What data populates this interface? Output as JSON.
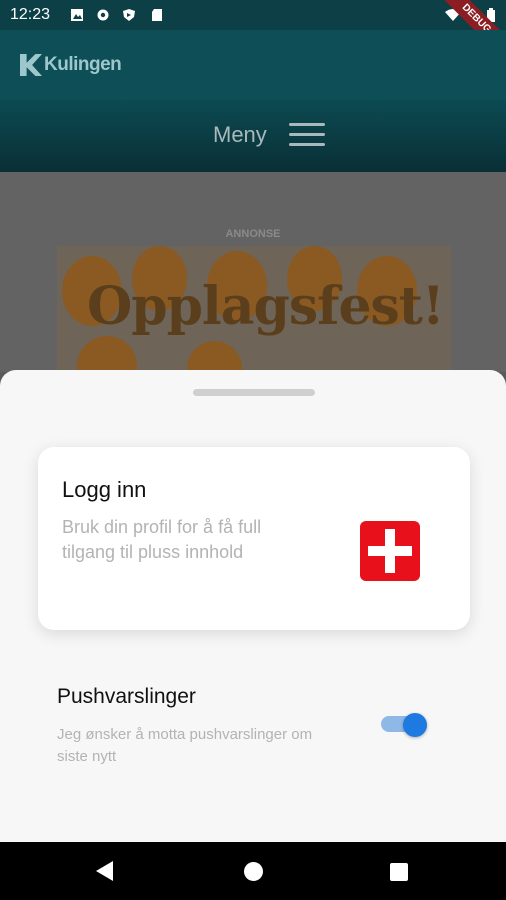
{
  "status_bar": {
    "time": "12:23",
    "icons": [
      "image-icon",
      "gear-icon",
      "shield-icon",
      "sd-card-icon",
      "wifi-icon",
      "signal-icon",
      "battery-icon"
    ],
    "debug_label": "DEBUG"
  },
  "app_bar": {
    "logo_text": "Kulingen"
  },
  "menu_bar": {
    "label": "Meny"
  },
  "ad": {
    "label": "ANNONSE",
    "banner_text": "Opplagsfest!"
  },
  "sheet": {
    "login": {
      "title": "Logg inn",
      "description": "Bruk din profil for å få full tilgang til pluss innhold"
    },
    "push": {
      "title": "Pushvarslinger",
      "description": "Jeg ønsker å motta pushvarslinger om siste nytt",
      "enabled": true
    }
  },
  "colors": {
    "appbar": "#0d4e57",
    "plus_red": "#e8111b",
    "toggle_blue": "#1e7ae0"
  }
}
